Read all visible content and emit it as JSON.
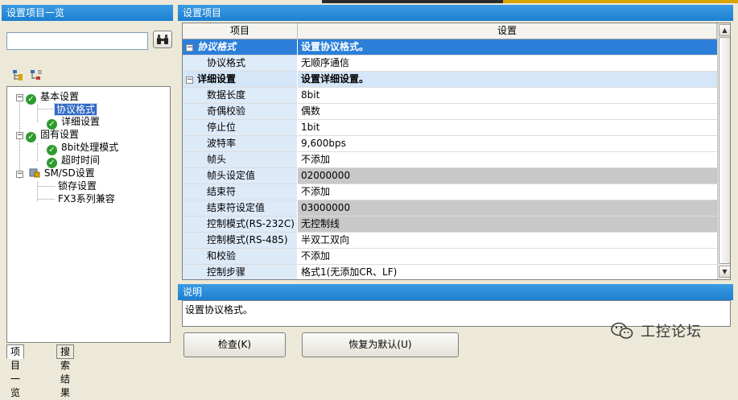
{
  "left_panel": {
    "title": "设置项目一览",
    "search": {
      "value": "",
      "placeholder": ""
    },
    "search_button_icon": "binoculars-icon",
    "toolbar_icons": [
      "expand-tree-icon",
      "collapse-tree-icon"
    ],
    "tree": {
      "basic": {
        "label": "基本设置",
        "children": {
          "protocol": "协议格式",
          "detail": "详细设置"
        }
      },
      "fixed": {
        "label": "固有设置",
        "children": {
          "mode8bit": "8bit处理模式",
          "timeout": "超时时间"
        }
      },
      "smsd": {
        "label": "SM/SD设置",
        "children": {
          "latch": "锁存设置",
          "fx3": "FX3系列兼容"
        }
      }
    },
    "tabs": {
      "items": "项目一览",
      "results": "搜索结果"
    }
  },
  "settings_panel": {
    "title": "设置项目",
    "col_item": "项目",
    "col_setting": "设置",
    "rows": [
      {
        "item": "协议格式",
        "value": "设置协议格式。",
        "kind": "section-selected"
      },
      {
        "item": "协议格式",
        "value": "无顺序通信",
        "kind": "row"
      },
      {
        "item": "详细设置",
        "value": "设置详细设置。",
        "kind": "section"
      },
      {
        "item": "数据长度",
        "value": "8bit",
        "kind": "row"
      },
      {
        "item": "奇偶校验",
        "value": "偶数",
        "kind": "row"
      },
      {
        "item": "停止位",
        "value": "1bit",
        "kind": "row"
      },
      {
        "item": "波特率",
        "value": "9,600bps",
        "kind": "row"
      },
      {
        "item": "帧头",
        "value": "不添加",
        "kind": "row"
      },
      {
        "item": "帧头设定值",
        "value": "02000000",
        "kind": "gray"
      },
      {
        "item": "结束符",
        "value": "不添加",
        "kind": "row"
      },
      {
        "item": "结束符设定值",
        "value": "03000000",
        "kind": "gray"
      },
      {
        "item": "控制模式(RS-232C)",
        "value": "无控制线",
        "kind": "gray"
      },
      {
        "item": "控制模式(RS-485)",
        "value": "半双工双向",
        "kind": "row"
      },
      {
        "item": "和校验",
        "value": "不添加",
        "kind": "row"
      },
      {
        "item": "控制步骤",
        "value": "格式1(无添加CR、LF)",
        "kind": "row"
      }
    ]
  },
  "description_panel": {
    "title": "说明",
    "text": "设置协议格式。"
  },
  "buttons": {
    "check": "检查(K)",
    "restore_default": "恢复为默认(U)"
  },
  "watermark": {
    "text": "工控论坛",
    "icon": "wechat-icon"
  },
  "colors": {
    "title_bar": "#1c7fd0",
    "selection": "#2b7fd8",
    "disabled_cell": "#c8c8c8"
  }
}
